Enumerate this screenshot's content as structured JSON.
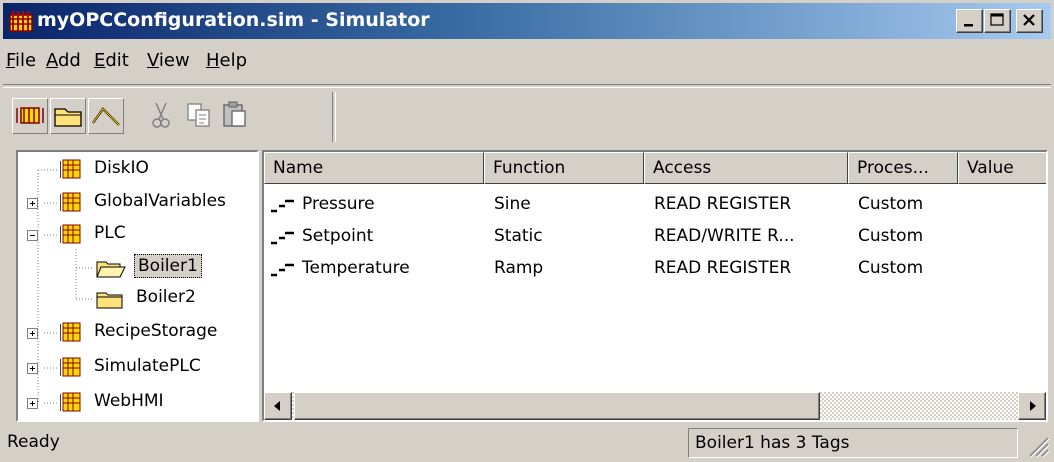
{
  "window": {
    "title": "myOPCConfiguration.sim - Simulator",
    "icons": {
      "app": "plc-grid-icon"
    }
  },
  "menu": [
    {
      "label": "File",
      "mnemonic": "F",
      "rest": "ile"
    },
    {
      "label": "Add",
      "mnemonic": "A",
      "rest": "dd"
    },
    {
      "label": "Edit",
      "mnemonic": "E",
      "rest": "dit"
    },
    {
      "label": "View",
      "mnemonic": "V",
      "rest": "iew"
    },
    {
      "label": "Help",
      "mnemonic": "H",
      "rest": "elp"
    }
  ],
  "toolbar": {
    "buttons": [
      "new-device-icon",
      "new-group-icon",
      "new-tag-icon",
      "cut-icon",
      "copy-icon",
      "paste-icon"
    ]
  },
  "tree": {
    "items": [
      {
        "label": "DiskIO",
        "icon": "device-icon",
        "expander": "none"
      },
      {
        "label": "GlobalVariables",
        "icon": "device-icon",
        "expander": "plus"
      },
      {
        "label": "PLC",
        "icon": "device-icon",
        "expander": "minus"
      },
      {
        "label": "Boiler1",
        "icon": "folder-open-icon",
        "selected": true
      },
      {
        "label": "Boiler2",
        "icon": "folder-icon"
      },
      {
        "label": "RecipeStorage",
        "icon": "device-icon",
        "expander": "plus"
      },
      {
        "label": "SimulatePLC",
        "icon": "device-icon",
        "expander": "plus"
      },
      {
        "label": "WebHMI",
        "icon": "device-icon",
        "expander": "plus"
      }
    ]
  },
  "list": {
    "columns": [
      "Name",
      "Function",
      "Access",
      "Proces...",
      "Value"
    ],
    "rows": [
      {
        "name": "Pressure",
        "function": "Sine",
        "access": "READ REGISTER",
        "process": "Custom",
        "value": ""
      },
      {
        "name": "Setpoint",
        "function": "Static",
        "access": "READ/WRITE R...",
        "process": "Custom",
        "value": ""
      },
      {
        "name": "Temperature",
        "function": "Ramp",
        "access": "READ REGISTER",
        "process": "Custom",
        "value": ""
      }
    ]
  },
  "status": {
    "main": "Ready",
    "info": "Boiler1 has 3 Tags"
  },
  "colors": {
    "titlebar_start": "#0a246a",
    "titlebar_end": "#a6caf0",
    "face": "#d4d0c8"
  }
}
